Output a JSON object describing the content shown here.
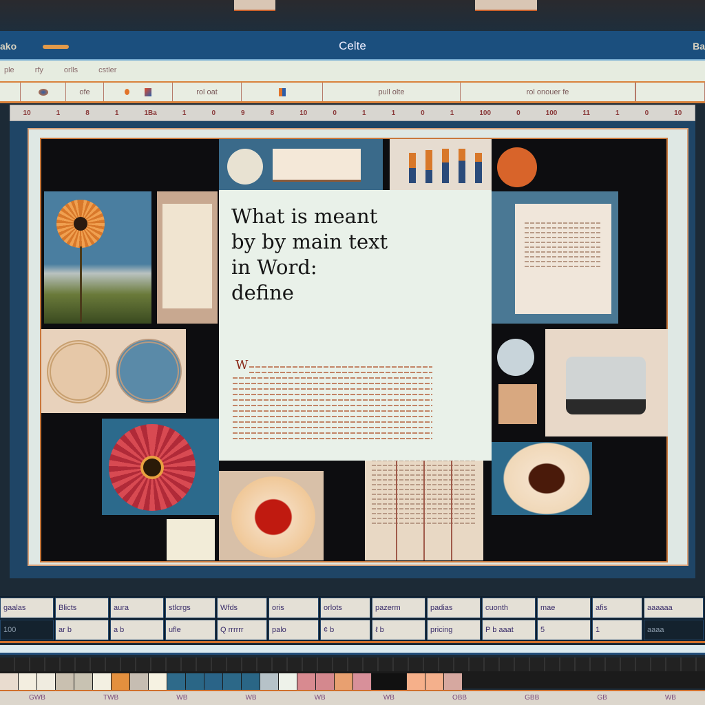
{
  "window": {
    "title": "Celte",
    "left_label": "ako",
    "right_label": "Ba"
  },
  "menu": {
    "items": [
      "ple",
      "rfy",
      "orlls",
      "cstler"
    ]
  },
  "toolbar": {
    "groups": [
      {
        "label": ""
      },
      {
        "label": ""
      },
      {
        "label": "ofe"
      },
      {
        "label": ""
      },
      {
        "label": "rol   oat"
      },
      {
        "label": ""
      },
      {
        "label": "pull   olte"
      },
      {
        "label": "rol   onouer fe"
      },
      {
        "label": ""
      }
    ]
  },
  "ruler": {
    "ticks": [
      "10",
      "1",
      "8",
      "1",
      "1Ba",
      "1",
      "0",
      "9",
      "8",
      "10",
      "0",
      "1",
      "1",
      "0",
      "1",
      "100",
      "0",
      "100",
      "11",
      "1",
      "0",
      "10"
    ]
  },
  "document": {
    "heading": "What is meant by by main text in Word: define",
    "heading_lines": [
      "What is meant",
      "by by main text",
      "in Word:",
      "define"
    ],
    "drop_cap": "W"
  },
  "table": {
    "header": [
      "gaalas",
      "Blicts",
      "aura",
      "stlcrgs",
      "Wfds",
      "oris",
      "orlots",
      "pazerm",
      "padias",
      "cuonth",
      "mae",
      "afis",
      "aaaaaa"
    ],
    "row": [
      "100",
      "ar b",
      "a b",
      "ufle",
      "Q rrrrrr",
      "palo",
      "¢ b",
      "ℓ b",
      "pricing",
      "P b aaat",
      "5",
      "1",
      "aaaa"
    ]
  },
  "palette": {
    "colors": [
      "#e9dccf",
      "#f3eee0",
      "#f0ece0",
      "#c9c0b0",
      "#c8c2b2",
      "#f3f0e2",
      "#e4903e",
      "#c6bdb2",
      "#f6f2e2",
      "#2e6a8a",
      "#2a6686",
      "#2a6488",
      "#2c6888",
      "#2a6686",
      "#b6c2c8",
      "#eef2ea",
      "#d88a90",
      "#d4888e",
      "#e8a070",
      "#d8909a",
      "#111111",
      "#f6b08a",
      "#f4b08c",
      "#d6a8a0"
    ]
  },
  "bottom": {
    "labels": [
      "GWB",
      "TWB",
      "WB",
      "WB",
      "WB",
      "WB",
      "OBB",
      "GBB",
      "GB",
      "WB"
    ]
  },
  "colors": {
    "titlebar": "#1b4f7e",
    "accent": "#d9823c"
  }
}
